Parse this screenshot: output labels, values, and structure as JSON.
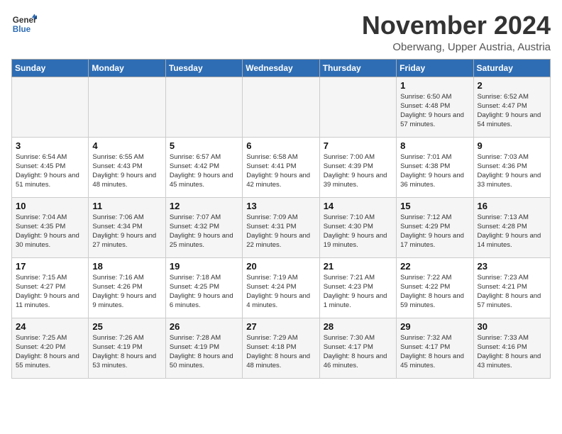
{
  "logo": {
    "line1": "General",
    "line2": "Blue"
  },
  "title": "November 2024",
  "location": "Oberwang, Upper Austria, Austria",
  "weekdays": [
    "Sunday",
    "Monday",
    "Tuesday",
    "Wednesday",
    "Thursday",
    "Friday",
    "Saturday"
  ],
  "weeks": [
    [
      {
        "day": "",
        "info": ""
      },
      {
        "day": "",
        "info": ""
      },
      {
        "day": "",
        "info": ""
      },
      {
        "day": "",
        "info": ""
      },
      {
        "day": "",
        "info": ""
      },
      {
        "day": "1",
        "info": "Sunrise: 6:50 AM\nSunset: 4:48 PM\nDaylight: 9 hours and 57 minutes."
      },
      {
        "day": "2",
        "info": "Sunrise: 6:52 AM\nSunset: 4:47 PM\nDaylight: 9 hours and 54 minutes."
      }
    ],
    [
      {
        "day": "3",
        "info": "Sunrise: 6:54 AM\nSunset: 4:45 PM\nDaylight: 9 hours and 51 minutes."
      },
      {
        "day": "4",
        "info": "Sunrise: 6:55 AM\nSunset: 4:43 PM\nDaylight: 9 hours and 48 minutes."
      },
      {
        "day": "5",
        "info": "Sunrise: 6:57 AM\nSunset: 4:42 PM\nDaylight: 9 hours and 45 minutes."
      },
      {
        "day": "6",
        "info": "Sunrise: 6:58 AM\nSunset: 4:41 PM\nDaylight: 9 hours and 42 minutes."
      },
      {
        "day": "7",
        "info": "Sunrise: 7:00 AM\nSunset: 4:39 PM\nDaylight: 9 hours and 39 minutes."
      },
      {
        "day": "8",
        "info": "Sunrise: 7:01 AM\nSunset: 4:38 PM\nDaylight: 9 hours and 36 minutes."
      },
      {
        "day": "9",
        "info": "Sunrise: 7:03 AM\nSunset: 4:36 PM\nDaylight: 9 hours and 33 minutes."
      }
    ],
    [
      {
        "day": "10",
        "info": "Sunrise: 7:04 AM\nSunset: 4:35 PM\nDaylight: 9 hours and 30 minutes."
      },
      {
        "day": "11",
        "info": "Sunrise: 7:06 AM\nSunset: 4:34 PM\nDaylight: 9 hours and 27 minutes."
      },
      {
        "day": "12",
        "info": "Sunrise: 7:07 AM\nSunset: 4:32 PM\nDaylight: 9 hours and 25 minutes."
      },
      {
        "day": "13",
        "info": "Sunrise: 7:09 AM\nSunset: 4:31 PM\nDaylight: 9 hours and 22 minutes."
      },
      {
        "day": "14",
        "info": "Sunrise: 7:10 AM\nSunset: 4:30 PM\nDaylight: 9 hours and 19 minutes."
      },
      {
        "day": "15",
        "info": "Sunrise: 7:12 AM\nSunset: 4:29 PM\nDaylight: 9 hours and 17 minutes."
      },
      {
        "day": "16",
        "info": "Sunrise: 7:13 AM\nSunset: 4:28 PM\nDaylight: 9 hours and 14 minutes."
      }
    ],
    [
      {
        "day": "17",
        "info": "Sunrise: 7:15 AM\nSunset: 4:27 PM\nDaylight: 9 hours and 11 minutes."
      },
      {
        "day": "18",
        "info": "Sunrise: 7:16 AM\nSunset: 4:26 PM\nDaylight: 9 hours and 9 minutes."
      },
      {
        "day": "19",
        "info": "Sunrise: 7:18 AM\nSunset: 4:25 PM\nDaylight: 9 hours and 6 minutes."
      },
      {
        "day": "20",
        "info": "Sunrise: 7:19 AM\nSunset: 4:24 PM\nDaylight: 9 hours and 4 minutes."
      },
      {
        "day": "21",
        "info": "Sunrise: 7:21 AM\nSunset: 4:23 PM\nDaylight: 9 hours and 1 minute."
      },
      {
        "day": "22",
        "info": "Sunrise: 7:22 AM\nSunset: 4:22 PM\nDaylight: 8 hours and 59 minutes."
      },
      {
        "day": "23",
        "info": "Sunrise: 7:23 AM\nSunset: 4:21 PM\nDaylight: 8 hours and 57 minutes."
      }
    ],
    [
      {
        "day": "24",
        "info": "Sunrise: 7:25 AM\nSunset: 4:20 PM\nDaylight: 8 hours and 55 minutes."
      },
      {
        "day": "25",
        "info": "Sunrise: 7:26 AM\nSunset: 4:19 PM\nDaylight: 8 hours and 53 minutes."
      },
      {
        "day": "26",
        "info": "Sunrise: 7:28 AM\nSunset: 4:19 PM\nDaylight: 8 hours and 50 minutes."
      },
      {
        "day": "27",
        "info": "Sunrise: 7:29 AM\nSunset: 4:18 PM\nDaylight: 8 hours and 48 minutes."
      },
      {
        "day": "28",
        "info": "Sunrise: 7:30 AM\nSunset: 4:17 PM\nDaylight: 8 hours and 46 minutes."
      },
      {
        "day": "29",
        "info": "Sunrise: 7:32 AM\nSunset: 4:17 PM\nDaylight: 8 hours and 45 minutes."
      },
      {
        "day": "30",
        "info": "Sunrise: 7:33 AM\nSunset: 4:16 PM\nDaylight: 8 hours and 43 minutes."
      }
    ]
  ]
}
